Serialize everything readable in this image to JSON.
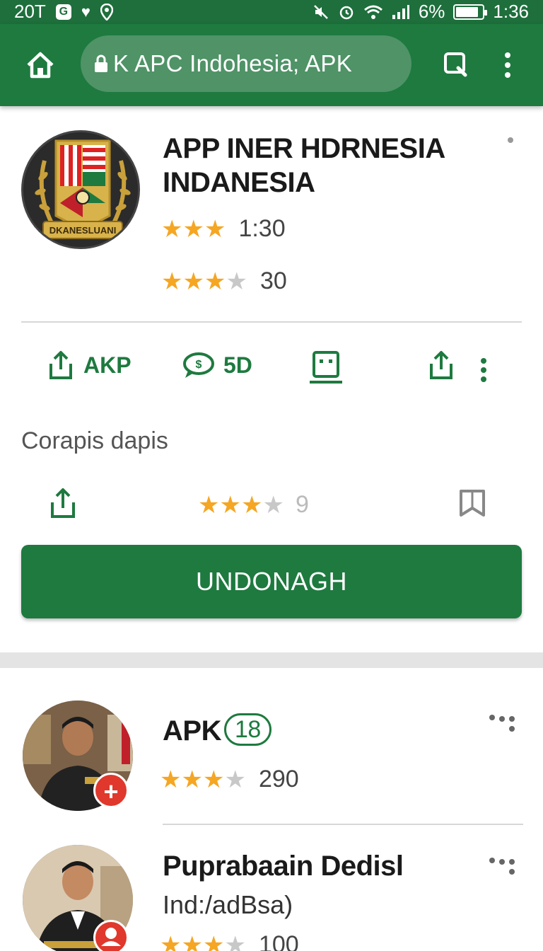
{
  "status_bar": {
    "time_left": "20T",
    "battery": "6%",
    "battery_level": 0.85,
    "time": "1:36",
    "icons": [
      "g-badge",
      "heart-icon",
      "location-icon",
      "mute-icon",
      "alarm-icon",
      "wifi-icon",
      "signal-icon",
      "battery-icon"
    ]
  },
  "toolbar": {
    "url": "K APC Indohesia; APK",
    "icons": [
      "home-icon",
      "lock-icon",
      "tabs-icon",
      "more-vert-icon"
    ]
  },
  "app": {
    "title": "APP INER HDRNESIA INDANESIA",
    "rating_primary": {
      "stars": 3,
      "max": 3,
      "value": "1:30"
    },
    "rating_secondary": {
      "stars": 3,
      "max": 4,
      "value": "30"
    },
    "logo_text": "DKANESLUANI"
  },
  "actions": [
    {
      "label": "AKP",
      "icon": "share-icon"
    },
    {
      "label": "5D",
      "icon": "chat-icon"
    },
    {
      "label": "",
      "icon": "device-icon"
    },
    {
      "label": "",
      "icon": "share-icon"
    }
  ],
  "section": {
    "label": "Corapis dapis",
    "rating": {
      "stars": 3,
      "max": 4,
      "value": "9"
    },
    "download_label": "UNDONAGH"
  },
  "list": [
    {
      "title": "APK",
      "badge": "18",
      "rating": {
        "stars": 3,
        "max": 4,
        "value": "290"
      },
      "avatar_badge": "+"
    },
    {
      "title": "Pupraba­ain Dedisl",
      "subtitle": "Ind:/adBsa)",
      "rating": {
        "stars": 3,
        "max": 4,
        "value": "100"
      }
    }
  ],
  "colors": {
    "brand_green": "#1e7a3f",
    "star": "#f5a623",
    "badge_red": "#e0382c"
  }
}
